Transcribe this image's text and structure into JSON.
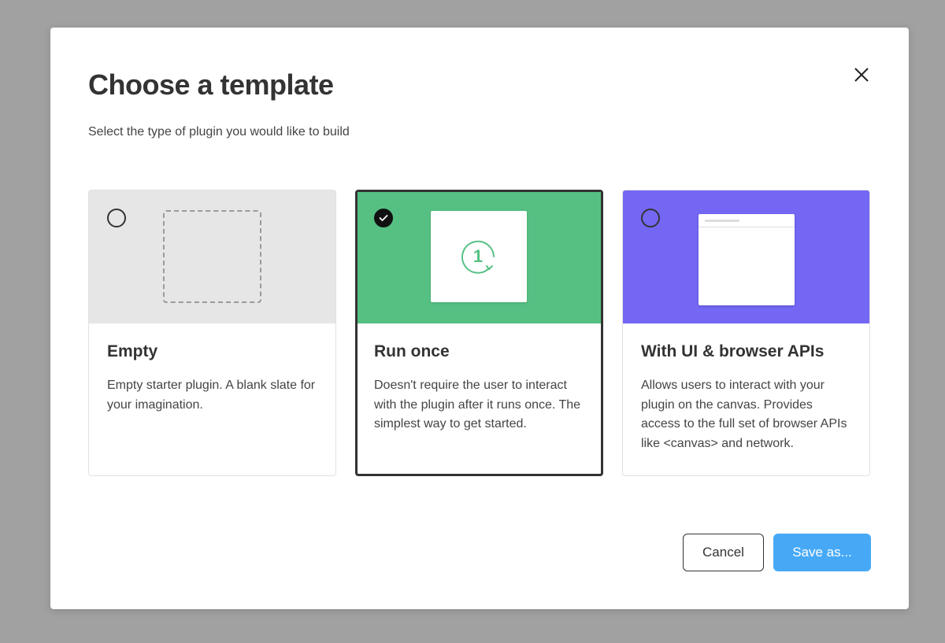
{
  "dialog": {
    "title": "Choose a template",
    "subtitle": "Select the type of plugin you would like to build"
  },
  "cards": [
    {
      "title": "Empty",
      "description": "Empty starter plugin. A blank slate for your imagination.",
      "selected": false,
      "color": "#e6e6e6",
      "icon": "dashed-square-icon"
    },
    {
      "title": "Run once",
      "description": "Doesn't require the user to interact with the plugin after it runs once. The simplest way to get started.",
      "selected": true,
      "color": "#56c083",
      "icon": "run-once-icon",
      "icon_label": "1"
    },
    {
      "title": "With UI & browser APIs",
      "description": "Allows users to interact with your plugin on the canvas. Provides access to the full set of browser APIs like <canvas> and network.",
      "selected": false,
      "color": "#7467f4",
      "icon": "window-icon"
    }
  ],
  "buttons": {
    "cancel_label": "Cancel",
    "save_label": "Save as..."
  },
  "colors": {
    "accent": "#47a9f6",
    "selected_border": "#333333"
  }
}
